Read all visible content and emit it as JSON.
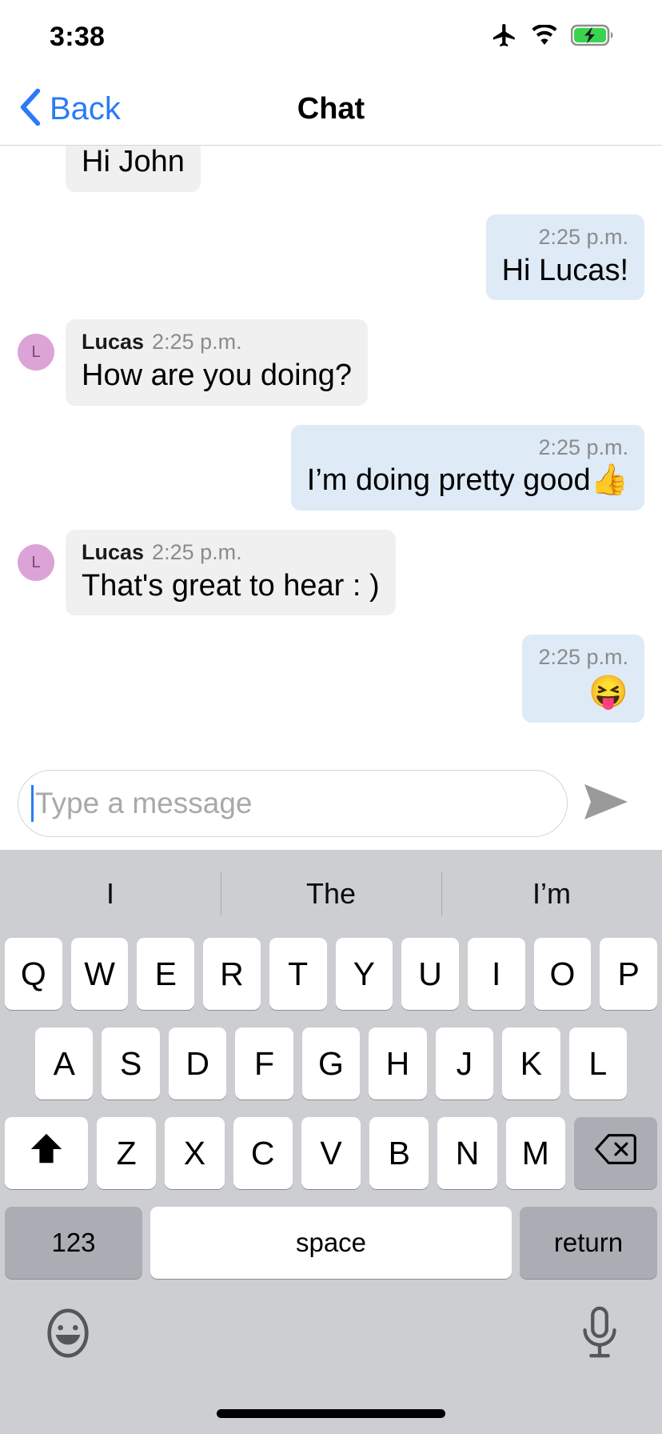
{
  "status_bar": {
    "time": "3:38",
    "icons": [
      "airplane-icon",
      "wifi-icon",
      "battery-charging-icon"
    ]
  },
  "nav_bar": {
    "back_label": "Back",
    "back_icon": "chevron-left-icon",
    "title": "Chat",
    "accent_color": "#2b7bf6"
  },
  "conversation": {
    "messages": [
      {
        "direction": "in",
        "sender": "",
        "time": "",
        "text": "Hi John",
        "avatar_letter": "",
        "clipped": true
      },
      {
        "direction": "out",
        "sender": "",
        "time": "2:25 p.m.",
        "text": "Hi Lucas!",
        "avatar_letter": ""
      },
      {
        "direction": "in",
        "sender": "Lucas",
        "time": "2:25 p.m.",
        "text": "How are you doing?",
        "avatar_letter": "L"
      },
      {
        "direction": "out",
        "sender": "",
        "time": "2:25 p.m.",
        "text": "I’m doing pretty good👍",
        "avatar_letter": ""
      },
      {
        "direction": "in",
        "sender": "Lucas",
        "time": "2:25 p.m.",
        "text": "That's great to hear : )",
        "avatar_letter": "L"
      },
      {
        "direction": "out",
        "sender": "",
        "time": "2:25 p.m.",
        "text": "😝",
        "avatar_letter": ""
      }
    ],
    "incoming_bubble_color": "#f0f0f0",
    "outgoing_bubble_color": "#deeaf6",
    "avatar_color": "#dca3d6"
  },
  "composer": {
    "placeholder": "Type a message",
    "value": "",
    "send_icon": "send-arrow-icon"
  },
  "keyboard": {
    "predictions": [
      "I",
      "The",
      "I’m"
    ],
    "row1": [
      "Q",
      "W",
      "E",
      "R",
      "T",
      "Y",
      "U",
      "I",
      "O",
      "P"
    ],
    "row2": [
      "A",
      "S",
      "D",
      "F",
      "G",
      "H",
      "J",
      "K",
      "L"
    ],
    "row3": [
      "Z",
      "X",
      "C",
      "V",
      "B",
      "N",
      "M"
    ],
    "shift_icon": "shift-up-arrow-icon",
    "backspace_icon": "backspace-delete-icon",
    "numbers_label": "123",
    "space_label": "space",
    "return_label": "return",
    "emoji_icon": "emoji-smiley-icon",
    "mic_icon": "microphone-icon",
    "background_color": "#cdced2",
    "key_color": "#ffffff",
    "modifier_key_color": "#abadb4"
  }
}
